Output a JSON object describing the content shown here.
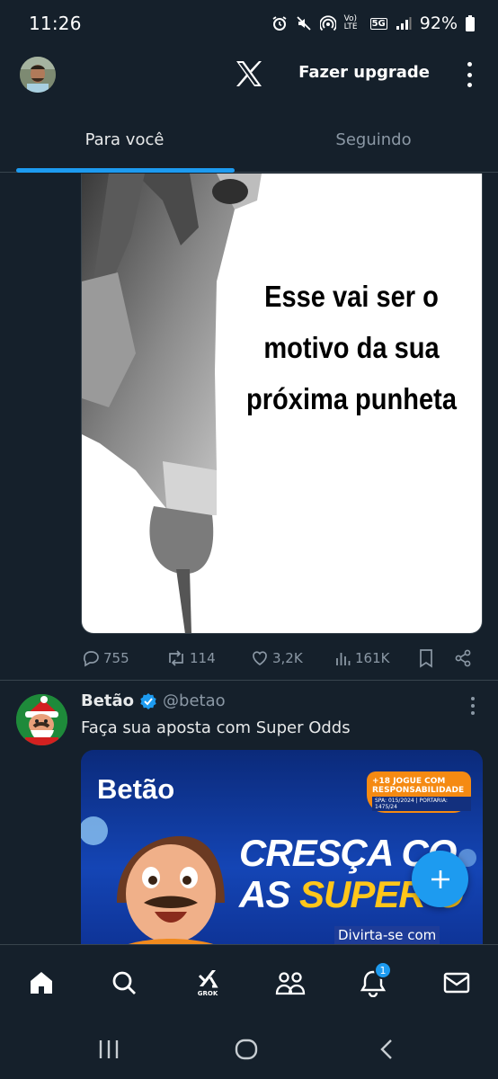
{
  "status_bar": {
    "time": "11:26",
    "network_lte": "Vo) LTE",
    "network_5g": "5G",
    "battery": "92%"
  },
  "header": {
    "logo": "x-logo",
    "upgrade_label": "Fazer upgrade"
  },
  "tabs": [
    {
      "label": "Para você",
      "active": true
    },
    {
      "label": "Seguindo",
      "active": false
    }
  ],
  "tweet1": {
    "media_text_lines": [
      "Esse vai ser o",
      "motivo da sua",
      "próxima punheta"
    ],
    "replies": "755",
    "reposts": "114",
    "likes": "3,2K",
    "views": "161K"
  },
  "tweet2": {
    "name": "Betão",
    "verified": true,
    "handle": "@betao",
    "text": "Faça sua aposta com Super Odds",
    "banner": {
      "logo": "Betão",
      "age_badge": "+18 JOGUE COM RESPONSABILIDADE",
      "age_sub": "SPA: 015/2024 | PORTARIA: 1475/24",
      "title_line1": "CRESÇA CO",
      "title_line2_white": "AS ",
      "title_line2_yellow": "SUPER O",
      "tagline": "Divirta-se com"
    }
  },
  "bottom_nav": {
    "items": [
      "home-icon",
      "search-icon",
      "grok-icon",
      "communities-icon",
      "notifications-icon",
      "messages-icon"
    ],
    "grok_label": "GROK",
    "notification_count": "1"
  },
  "colors": {
    "background": "#15202b",
    "accent": "#1d9bf0",
    "muted": "#8b98a5",
    "border": "#38444d"
  }
}
